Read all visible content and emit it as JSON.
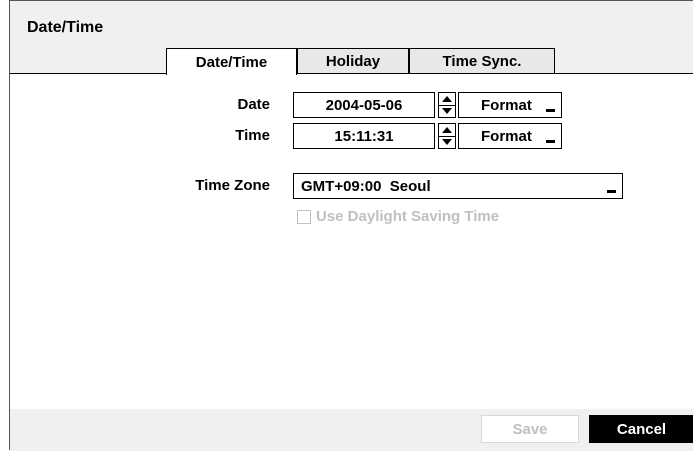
{
  "window": {
    "title": "Date/Time"
  },
  "tabs": [
    {
      "label": "Date/Time",
      "active": true
    },
    {
      "label": "Holiday",
      "active": false
    },
    {
      "label": "Time Sync.",
      "active": false
    }
  ],
  "form": {
    "date": {
      "label": "Date",
      "value": "2004-05-06",
      "format_label": "Format"
    },
    "time": {
      "label": "Time",
      "value": "15:11:31",
      "format_label": "Format"
    },
    "time_zone": {
      "label": "Time Zone",
      "value": "GMT+09:00  Seoul"
    },
    "daylight_saving": {
      "label": "Use Daylight Saving Time",
      "checked": false,
      "enabled": false
    }
  },
  "footer": {
    "save_label": "Save",
    "cancel_label": "Cancel"
  },
  "colors": {
    "disabled_text": "#c0c0c0",
    "cancel_bg": "#000000",
    "panel_bg": "#f0f0f0"
  }
}
